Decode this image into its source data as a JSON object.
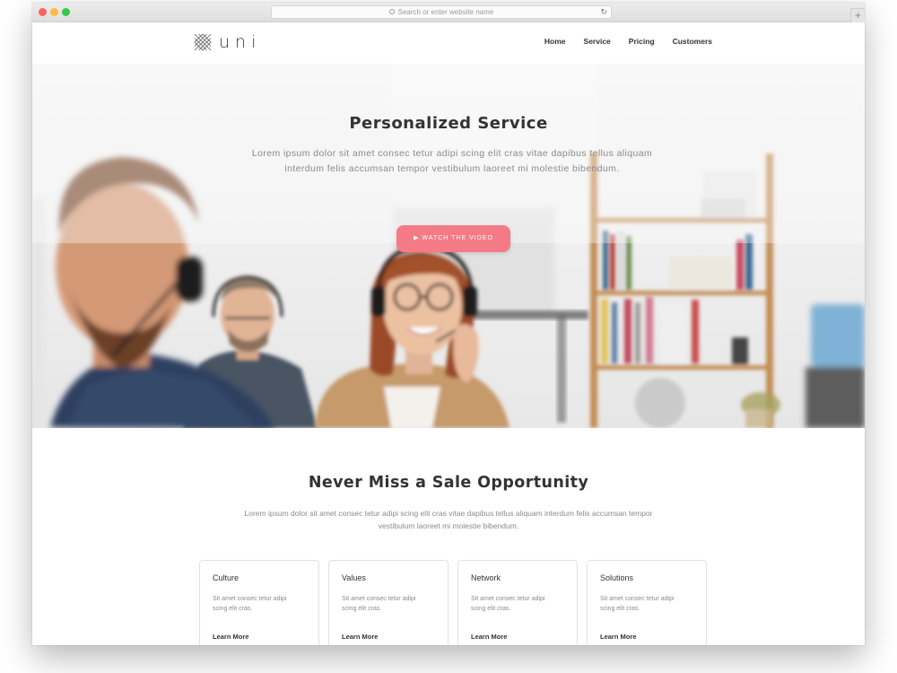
{
  "browser": {
    "address_placeholder": "Search or enter website name",
    "reload_icon": "reload-icon",
    "newtab_icon": "plus-icon"
  },
  "site": {
    "logo_text": "uni",
    "nav": [
      "Home",
      "Service",
      "Pricing",
      "Customers"
    ]
  },
  "hero": {
    "title": "Personalized Service",
    "text": "Lorem ipsum dolor sit amet consec tetur adipi scing elit cras vitae dapibus tellus aliquam interdum felis accumsan tempor vestibulum laoreet mi molestie bibendum.",
    "cta_label": "WATCH THE VIDEO",
    "cta_color": "#f47b86"
  },
  "section": {
    "title": "Never Miss a Sale Opportunity",
    "text": "Lorem ipsum dolor sit amet consec tetur adipi scing elit cras vitae dapibus tellus aliquam interdum felis accumsan tempor vestibulum laoreet mi molestie bibendum."
  },
  "cards": [
    {
      "title": "Culture",
      "text": "Sit amet consec tetur adipi scing elit cras.",
      "link": "Learn More"
    },
    {
      "title": "Values",
      "text": "Sit amet consec tetur adipi scing elit cras.",
      "link": "Learn More"
    },
    {
      "title": "Network",
      "text": "Sit amet consec tetur adipi scing elit cras.",
      "link": "Learn More"
    },
    {
      "title": "Solutions",
      "text": "Sit amet consec tetur adipi scing elit cras.",
      "link": "Learn More"
    }
  ]
}
